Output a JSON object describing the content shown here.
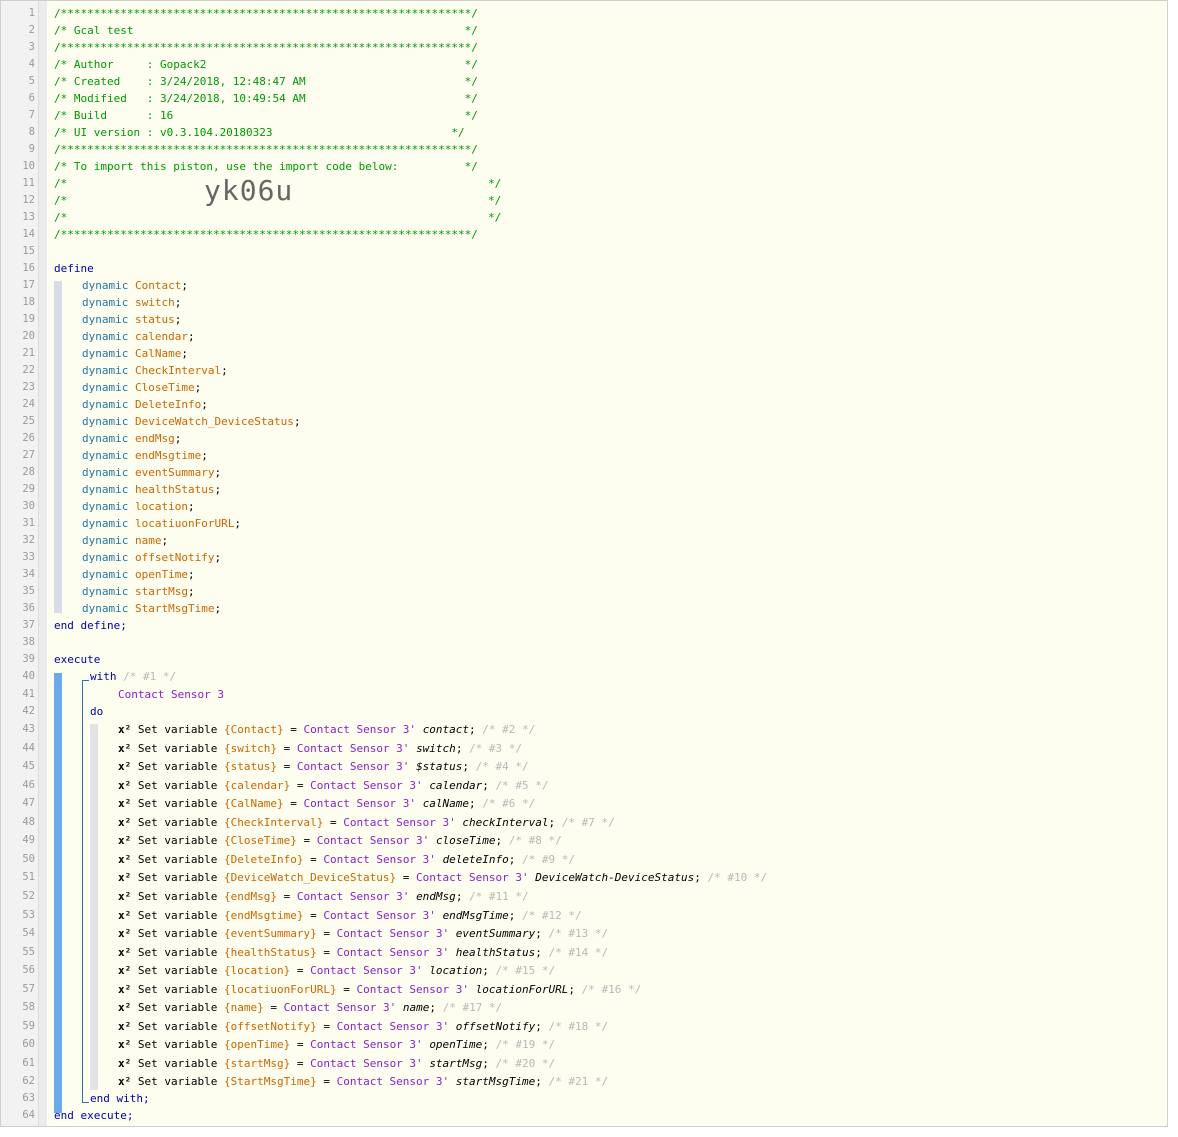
{
  "lines": [
    {
      "n": "1"
    },
    {
      "n": "2"
    },
    {
      "n": "3"
    },
    {
      "n": "4"
    },
    {
      "n": "5"
    },
    {
      "n": "6"
    },
    {
      "n": "7"
    },
    {
      "n": "8"
    },
    {
      "n": "9"
    },
    {
      "n": "10"
    },
    {
      "n": "11"
    },
    {
      "n": "12"
    },
    {
      "n": "13"
    },
    {
      "n": "14"
    },
    {
      "n": "15"
    },
    {
      "n": "16"
    },
    {
      "n": "17"
    },
    {
      "n": "18"
    },
    {
      "n": "19"
    },
    {
      "n": "20"
    },
    {
      "n": "21"
    },
    {
      "n": "22"
    },
    {
      "n": "23"
    },
    {
      "n": "24"
    },
    {
      "n": "25"
    },
    {
      "n": "26"
    },
    {
      "n": "27"
    },
    {
      "n": "28"
    },
    {
      "n": "29"
    },
    {
      "n": "30"
    },
    {
      "n": "31"
    },
    {
      "n": "32"
    },
    {
      "n": "33"
    },
    {
      "n": "34"
    },
    {
      "n": "35"
    },
    {
      "n": "36"
    },
    {
      "n": "37"
    },
    {
      "n": "38"
    },
    {
      "n": "39"
    },
    {
      "n": "40"
    },
    {
      "n": "41"
    },
    {
      "n": "42"
    },
    {
      "n": "43"
    },
    {
      "n": "44"
    },
    {
      "n": "45"
    },
    {
      "n": "46"
    },
    {
      "n": "47"
    },
    {
      "n": "48"
    },
    {
      "n": "49"
    },
    {
      "n": "50"
    },
    {
      "n": "51"
    },
    {
      "n": "52"
    },
    {
      "n": "53"
    },
    {
      "n": "54"
    },
    {
      "n": "55"
    },
    {
      "n": "56"
    },
    {
      "n": "57"
    },
    {
      "n": "58"
    },
    {
      "n": "59"
    },
    {
      "n": "60"
    },
    {
      "n": "61"
    },
    {
      "n": "62"
    },
    {
      "n": "63"
    },
    {
      "n": "64"
    }
  ],
  "header": {
    "border": "/**************************************************************/",
    "title": "/* Gcal test                                                  */",
    "author": "/* Author     : Gopack2                                       */",
    "created": "/* Created    : 3/24/2018, 12:48:47 AM                        */",
    "modified": "/* Modified   : 3/24/2018, 10:49:54 AM                        */",
    "build": "/* Build      : 16                                            */",
    "ui_version": "/* UI version : v0.3.104.20180323                           */",
    "import_note": "/* To import this piston, use the import code below:          */",
    "blank_left": "/*",
    "blank_right": "*/",
    "import_code": "yk06u"
  },
  "define": {
    "open": "define",
    "close": "end define;",
    "keyword": "dynamic",
    "vars": [
      "Contact",
      "switch",
      "status",
      "calendar",
      "CalName",
      "CheckInterval",
      "CloseTime",
      "DeleteInfo",
      "DeviceWatch_DeviceStatus",
      "endMsg",
      "endMsgtime",
      "eventSummary",
      "healthStatus",
      "location",
      "locatiuonForURL",
      "name",
      "offsetNotify",
      "openTime",
      "startMsg",
      "StartMsgTime"
    ]
  },
  "execute": {
    "open": "execute",
    "close": "end execute;",
    "with_kw": "with",
    "with_comment": "/* #1 */",
    "device": "Contact Sensor 3",
    "do_kw": "do",
    "end_with": "end with;",
    "statements": [
      {
        "var": "{Contact}",
        "attr": "contact",
        "comment": "/* #2 */"
      },
      {
        "var": "{switch}",
        "attr": "switch",
        "comment": "/* #3 */"
      },
      {
        "var": "{status}",
        "attr": "$status",
        "comment": "/* #4 */"
      },
      {
        "var": "{calendar}",
        "attr": "calendar",
        "comment": "/* #5 */"
      },
      {
        "var": "{CalName}",
        "attr": "calName",
        "comment": "/* #6 */"
      },
      {
        "var": "{CheckInterval}",
        "attr": "checkInterval",
        "comment": "/* #7 */"
      },
      {
        "var": "{CloseTime}",
        "attr": "closeTime",
        "comment": "/* #8 */"
      },
      {
        "var": "{DeleteInfo}",
        "attr": "deleteInfo",
        "comment": "/* #9 */"
      },
      {
        "var": "{DeviceWatch_DeviceStatus}",
        "attr": "DeviceWatch-DeviceStatus",
        "comment": "/* #10 */"
      },
      {
        "var": "{endMsg}",
        "attr": "endMsg",
        "comment": "/* #11 */"
      },
      {
        "var": "{endMsgtime}",
        "attr": "endMsgTime",
        "comment": "/* #12 */"
      },
      {
        "var": "{eventSummary}",
        "attr": "eventSummary",
        "comment": "/* #13 */"
      },
      {
        "var": "{healthStatus}",
        "attr": "healthStatus",
        "comment": "/* #14 */"
      },
      {
        "var": "{location}",
        "attr": "location",
        "comment": "/* #15 */"
      },
      {
        "var": "{locatiuonForURL}",
        "attr": "locationForURL",
        "comment": "/* #16 */"
      },
      {
        "var": "{name}",
        "attr": "name",
        "comment": "/* #17 */"
      },
      {
        "var": "{offsetNotify}",
        "attr": "offsetNotify",
        "comment": "/* #18 */"
      },
      {
        "var": "{openTime}",
        "attr": "openTime",
        "comment": "/* #19 */"
      },
      {
        "var": "{startMsg}",
        "attr": "startMsg",
        "comment": "/* #20 */"
      },
      {
        "var": "{StartMsgTime}",
        "attr": "startMsgTime",
        "comment": "/* #21 */"
      }
    ],
    "x2": "x²",
    "set_variable": "Set variable",
    "equals": "=",
    "device_short": "Contact Sensor 3'",
    "semicolon": ";"
  }
}
